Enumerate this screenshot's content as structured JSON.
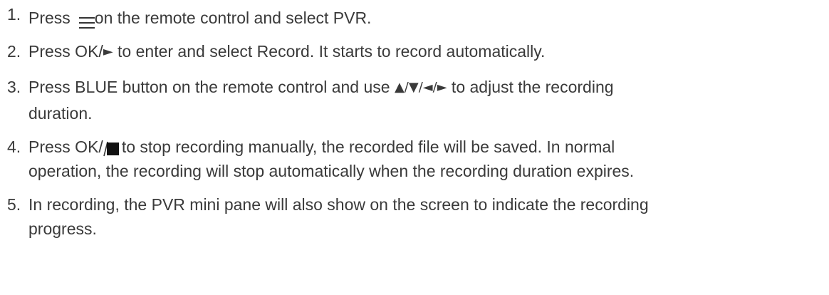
{
  "steps": [
    {
      "number": "1.",
      "before": "Press",
      "icon": "menu-icon",
      "after": "on the remote control and select PVR."
    },
    {
      "number": "2.",
      "before": "Press OK/",
      "glyph": "►",
      "after": " to enter and select Record. It starts to record automatically."
    },
    {
      "number": "3.",
      "before": "Press BLUE button on the remote control and use ",
      "glyph": "▲/▼/◄/►",
      "after": " to adjust the recording",
      "continuation": "duration."
    },
    {
      "number": "4.",
      "before": "Press OK/",
      "icon": "stop-icon",
      "after": "to stop recording manually, the recorded file will be saved. In normal",
      "continuation": "operation, the recording will stop automatically when the recording duration expires."
    },
    {
      "number": "5.",
      "text": "In recording, the PVR mini pane will also show on the screen to indicate the recording",
      "continuation": "progress."
    }
  ]
}
